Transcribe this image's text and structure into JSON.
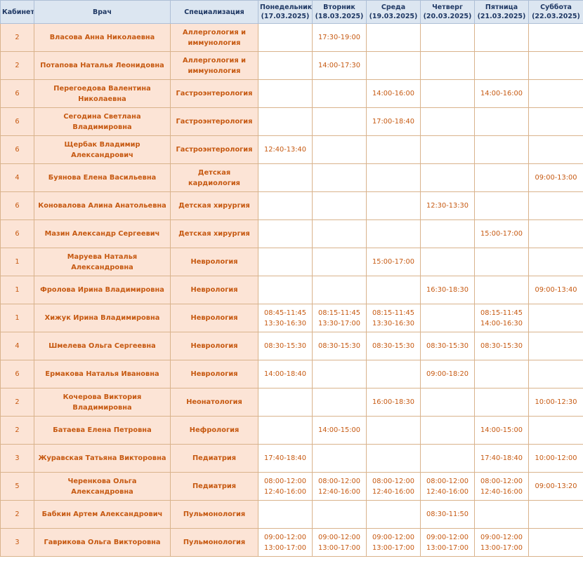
{
  "headers": {
    "cabinet": "Кабинет",
    "doctor": "Врач",
    "specialization": "Специализация",
    "days": [
      {
        "name": "Понедельник",
        "date": "(17.03.2025)"
      },
      {
        "name": "Вторник",
        "date": "(18.03.2025)"
      },
      {
        "name": "Среда",
        "date": "(19.03.2025)"
      },
      {
        "name": "Четверг",
        "date": "(20.03.2025)"
      },
      {
        "name": "Пятница",
        "date": "(21.03.2025)"
      },
      {
        "name": "Суббота",
        "date": "(22.03.2025)"
      }
    ]
  },
  "rows": [
    {
      "cabinet": "2",
      "doctor": "Власова Анна Николаевна",
      "specialization": "Аллергология и иммунология",
      "slots": [
        "",
        "17:30-19:00",
        "",
        "",
        "",
        ""
      ]
    },
    {
      "cabinet": "2",
      "doctor": "Потапова Наталья Леонидовна",
      "specialization": "Аллергология и иммунология",
      "slots": [
        "",
        "14:00-17:30",
        "",
        "",
        "",
        ""
      ]
    },
    {
      "cabinet": "6",
      "doctor": "Перегоедова Валентина Николаевна",
      "specialization": "Гастроэнтерология",
      "slots": [
        "",
        "",
        "14:00-16:00",
        "",
        "14:00-16:00",
        ""
      ]
    },
    {
      "cabinet": "6",
      "doctor": "Сегодина Светлана Владимировна",
      "specialization": "Гастроэнтерология",
      "slots": [
        "",
        "",
        "17:00-18:40",
        "",
        "",
        ""
      ]
    },
    {
      "cabinet": "6",
      "doctor": "Щербак Владимир Александрович",
      "specialization": "Гастроэнтерология",
      "slots": [
        "12:40-13:40",
        "",
        "",
        "",
        "",
        ""
      ]
    },
    {
      "cabinet": "4",
      "doctor": "Буянова Елена Васильевна",
      "specialization": "Детская кардиология",
      "slots": [
        "",
        "",
        "",
        "",
        "",
        "09:00-13:00"
      ]
    },
    {
      "cabinet": "6",
      "doctor": "Коновалова Алина Анатольевна",
      "specialization": "Детская хирургия",
      "slots": [
        "",
        "",
        "",
        "12:30-13:30",
        "",
        ""
      ]
    },
    {
      "cabinet": "6",
      "doctor": "Мазин Александр Сергеевич",
      "specialization": "Детская хирургия",
      "slots": [
        "",
        "",
        "",
        "",
        "15:00-17:00",
        ""
      ]
    },
    {
      "cabinet": "1",
      "doctor": "Маруева Наталья Александровна",
      "specialization": "Неврология",
      "slots": [
        "",
        "",
        "15:00-17:00",
        "",
        "",
        ""
      ]
    },
    {
      "cabinet": "1",
      "doctor": "Фролова Ирина Владимировна",
      "specialization": "Неврология",
      "slots": [
        "",
        "",
        "",
        "16:30-18:30",
        "",
        "09:00-13:40"
      ]
    },
    {
      "cabinet": "1",
      "doctor": "Хижук Ирина Владимировна",
      "specialization": "Неврология",
      "slots": [
        "08:45-11:45\n13:30-16:30",
        "08:15-11:45\n13:30-17:00",
        "08:15-11:45\n13:30-16:30",
        "",
        "08:15-11:45\n14:00-16:30",
        ""
      ]
    },
    {
      "cabinet": "4",
      "doctor": "Шмелева Ольга Сергеевна",
      "specialization": "Неврология",
      "slots": [
        "08:30-15:30",
        "08:30-15:30",
        "08:30-15:30",
        "08:30-15:30",
        "08:30-15:30",
        ""
      ]
    },
    {
      "cabinet": "6",
      "doctor": "Ермакова Наталья Ивановна",
      "specialization": "Неврология",
      "slots": [
        "14:00-18:40",
        "",
        "",
        "09:00-18:20",
        "",
        ""
      ]
    },
    {
      "cabinet": "2",
      "doctor": "Кочерова Виктория Владимировна",
      "specialization": "Неонатология",
      "slots": [
        "",
        "",
        "16:00-18:30",
        "",
        "",
        "10:00-12:30"
      ]
    },
    {
      "cabinet": "2",
      "doctor": "Батаева Елена Петровна",
      "specialization": "Нефрология",
      "slots": [
        "",
        "14:00-15:00",
        "",
        "",
        "14:00-15:00",
        ""
      ]
    },
    {
      "cabinet": "3",
      "doctor": "Журавская Татьяна Викторовна",
      "specialization": "Педиатрия",
      "slots": [
        "17:40-18:40",
        "",
        "",
        "",
        "17:40-18:40",
        "10:00-12:00"
      ]
    },
    {
      "cabinet": "5",
      "doctor": "Черенкова Ольга Александровна",
      "specialization": "Педиатрия",
      "slots": [
        "08:00-12:00\n12:40-16:00",
        "08:00-12:00\n12:40-16:00",
        "08:00-12:00\n12:40-16:00",
        "08:00-12:00\n12:40-16:00",
        "08:00-12:00\n12:40-16:00",
        "09:00-13:20"
      ]
    },
    {
      "cabinet": "2",
      "doctor": "Бабкин Артем Александрович",
      "specialization": "Пульмонология",
      "slots": [
        "",
        "",
        "",
        "08:30-11:50",
        "",
        ""
      ]
    },
    {
      "cabinet": "3",
      "doctor": "Гаврикова Ольга Викторовна",
      "specialization": "Пульмонология",
      "slots": [
        "09:00-12:00\n13:00-17:00",
        "09:00-12:00\n13:00-17:00",
        "09:00-12:00\n13:00-17:00",
        "09:00-12:00\n13:00-17:00",
        "09:00-12:00\n13:00-17:00",
        ""
      ]
    }
  ]
}
